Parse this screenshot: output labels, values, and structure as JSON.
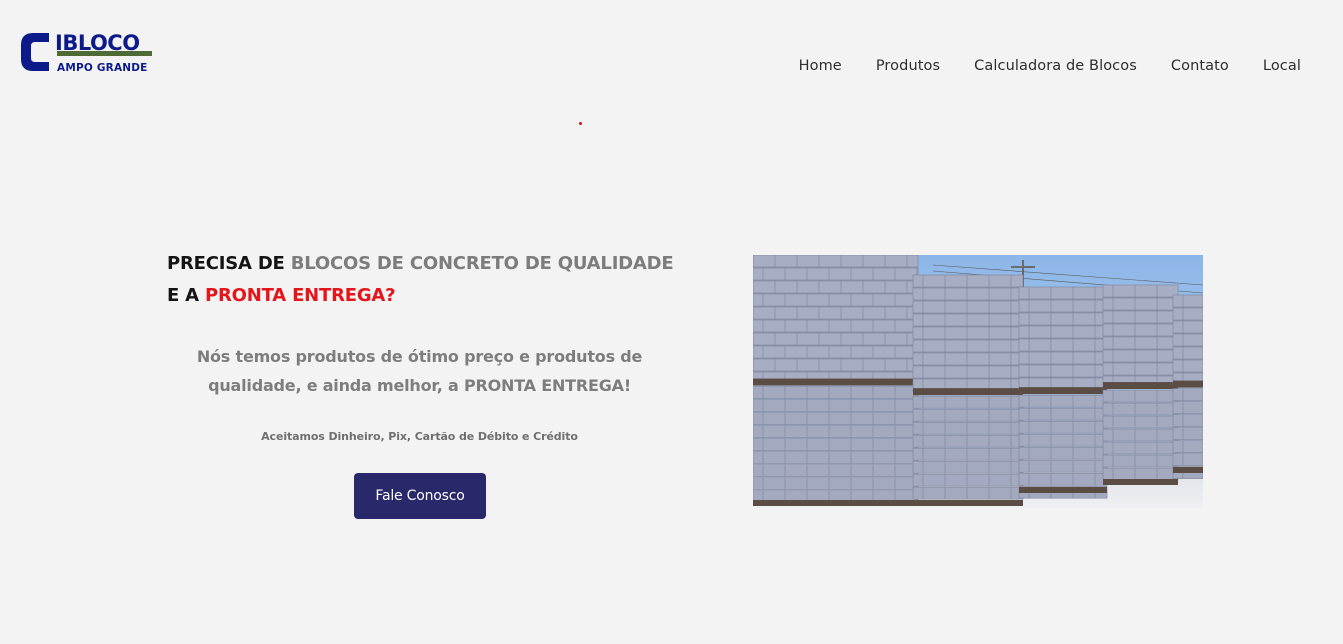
{
  "brand": {
    "logo_main": "IBLOCO",
    "logo_sub": "AMPO GRANDE",
    "logo_initial": "C",
    "colors": {
      "navy": "#0c1a8a",
      "green": "#4f6b35"
    }
  },
  "nav": {
    "items": [
      {
        "label": "Home"
      },
      {
        "label": "Produtos"
      },
      {
        "label": "Calculadora de Blocos"
      },
      {
        "label": "Contato"
      },
      {
        "label": "Local"
      }
    ]
  },
  "hero": {
    "headline_part1": "PRECISA DE ",
    "headline_part2": "BLOCOS DE CONCRETO DE QUALIDADE",
    "headline_part3": "E A ",
    "headline_part4": "PRONTA ENTREGA?",
    "subtext": "Nós temos produtos de ótimo preço e produtos de qualidade, e ainda melhor, a PRONTA ENTREGA!",
    "payment": "Aceitamos Dinheiro, Pix, Cartão de Débito e Crédito",
    "cta_label": "Fale Conosco",
    "image_alt": "concrete-block-pallets-photo"
  },
  "colors": {
    "background": "#f3f3f3",
    "accent_red": "#e4161b",
    "button": "#28286a",
    "headline_gray": "#7c7c7c"
  }
}
